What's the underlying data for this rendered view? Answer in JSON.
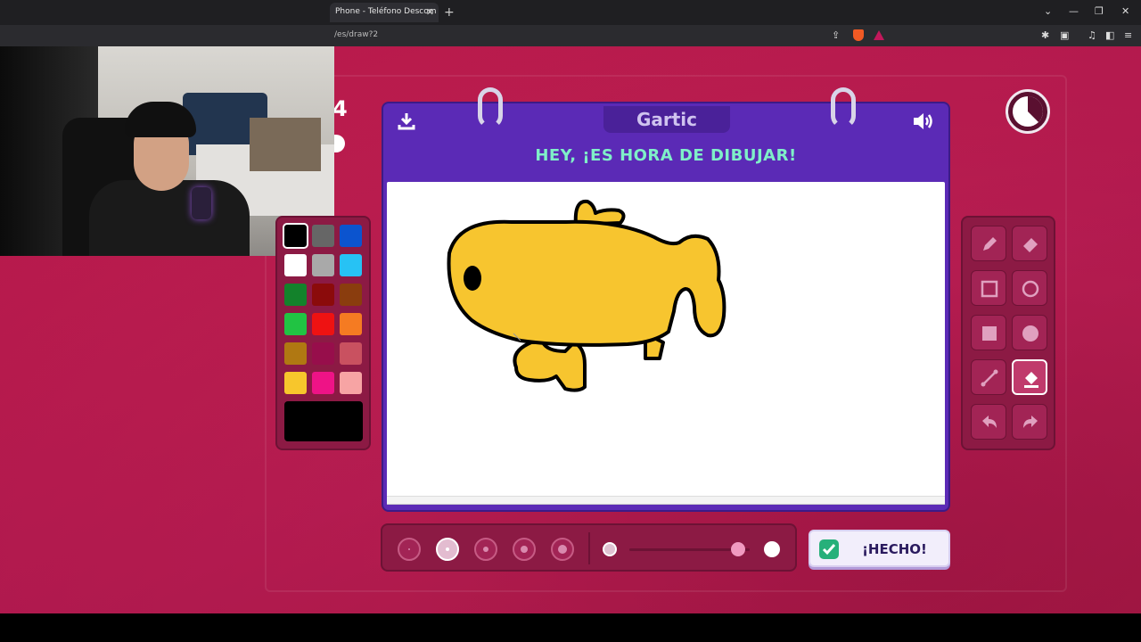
{
  "browser": {
    "tab_title": "Phone - Teléfono Descom",
    "tab_close": "✕",
    "new_tab": "+",
    "url": "/es/draw?2",
    "window_controls": [
      "⌄",
      "—",
      "❐",
      "✕"
    ]
  },
  "page": {
    "partial_number": "4",
    "logo": "Gartic",
    "title": "HEY, ¡ES HORA DE DIBUJAR!",
    "done_button": "¡HECHO!",
    "icons": {
      "download": "download-icon",
      "volume": "volume-icon",
      "timer": "timer-icon"
    }
  },
  "palette": {
    "colors": [
      "#000000",
      "#666666",
      "#0b54cf",
      "#ffffff",
      "#a9a9a9",
      "#27c2f4",
      "#13822b",
      "#8b0b0b",
      "#8a3d0e",
      "#21c343",
      "#ee1212",
      "#f57b22",
      "#b07812",
      "#970e4b",
      "#c95160",
      "#f7c62c",
      "#ee1386",
      "#f7a4a4"
    ],
    "selected": "#000000",
    "current": "#000000"
  },
  "tools": [
    "pencil",
    "eraser",
    "rectangle-outline",
    "circle-outline",
    "rectangle-filled",
    "circle-filled",
    "line",
    "fill-bucket",
    "undo",
    "redo"
  ],
  "active_tool": "fill-bucket",
  "brush_sizes": {
    "count": 5,
    "selected_index": 1
  },
  "opacity_slider": {
    "value": 0.9
  }
}
